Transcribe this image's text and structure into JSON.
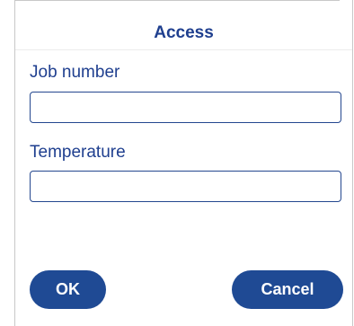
{
  "dialog": {
    "title": "Access"
  },
  "fields": {
    "job_number": {
      "label": "Job number",
      "value": "",
      "placeholder": ""
    },
    "temperature": {
      "label": "Temperature",
      "value": "",
      "placeholder": ""
    }
  },
  "buttons": {
    "ok_label": "OK",
    "cancel_label": "Cancel"
  },
  "colors": {
    "accent": "#1f4a94",
    "text": "#1f3f8f",
    "background": "#ffffff"
  }
}
